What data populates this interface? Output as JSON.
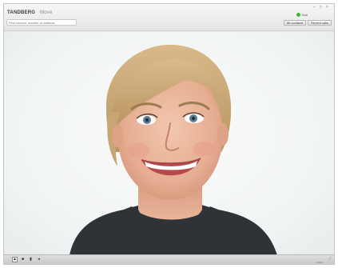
{
  "app": {
    "brand_name": "TANDBERG",
    "product_name": "Move"
  },
  "search": {
    "placeholder": "Find contact, number or address"
  },
  "status": {
    "text": "Kari",
    "color": "#3fb534"
  },
  "top_buttons": [
    {
      "label": "All contacts"
    },
    {
      "label": "Recent calls"
    }
  ],
  "window_controls": {
    "minimize_icon": "minimize-icon",
    "maximize_icon": "maximize-icon",
    "close_icon": "close-icon"
  },
  "bottom_bar": {
    "controls": [
      {
        "icon": "self-view-icon"
      },
      {
        "icon": "camera-icon"
      },
      {
        "icon": "microphone-icon"
      },
      {
        "icon": "speaker-icon"
      }
    ],
    "footer_text": "Quality"
  },
  "video": {
    "description_icon": "remote-video"
  }
}
